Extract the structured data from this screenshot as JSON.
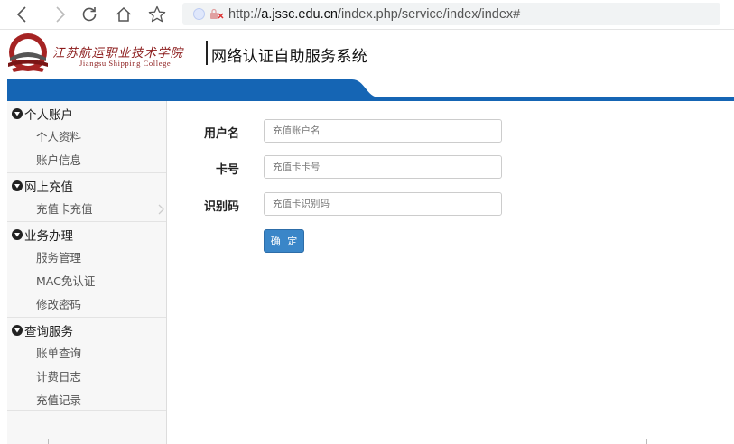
{
  "browser": {
    "url_prefix": "http://",
    "url_host": "a.jssc.edu.cn",
    "url_path": "/index.php/service/index/index#"
  },
  "header": {
    "college_name_cn": "江苏航运职业技术学院",
    "college_name_en": "Jiangsu Shipping College",
    "system_title": "网络认证自助服务系统"
  },
  "sidebar": {
    "groups": [
      {
        "title": "个人账户",
        "items": [
          "个人资料",
          "账户信息"
        ]
      },
      {
        "title": "网上充值",
        "items": [
          "充值卡充值"
        ]
      },
      {
        "title": "业务办理",
        "items": [
          "服务管理",
          "MAC免认证",
          "修改密码"
        ]
      },
      {
        "title": "查询服务",
        "items": [
          "账单查询",
          "计费日志",
          "充值记录"
        ]
      }
    ]
  },
  "form": {
    "username_label": "用户名",
    "username_placeholder": "充值账户名",
    "card_label": "卡号",
    "card_placeholder": "充值卡卡号",
    "code_label": "识别码",
    "code_placeholder": "充值卡识别码",
    "submit_label": "确 定"
  },
  "colors": {
    "brand_blue": "#1565b4",
    "button_blue": "#3a86c8",
    "logo_red": "#8b1a1a"
  },
  "icons": {
    "back": "chevron-left-icon",
    "forward": "chevron-right-icon",
    "reload": "reload-icon",
    "home": "home-icon",
    "bookmark": "star-icon",
    "security": "not-secure-icon",
    "group": "arrow-circle-down-icon",
    "active": "chevron-right-icon"
  }
}
